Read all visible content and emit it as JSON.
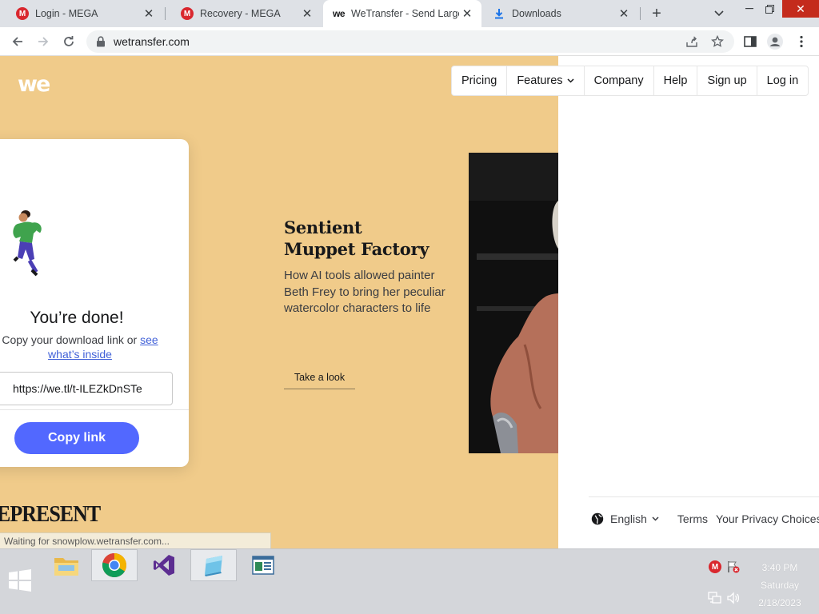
{
  "browser": {
    "tabs": [
      {
        "title": "Login - MEGA",
        "favicon": "mega-icon",
        "active": false
      },
      {
        "title": "Recovery - MEGA",
        "favicon": "mega-icon",
        "active": false
      },
      {
        "title": "WeTransfer - Send Large",
        "favicon": "wetransfer-icon",
        "active": true
      },
      {
        "title": "Downloads",
        "favicon": "download-icon",
        "active": false
      }
    ],
    "close_glyph": "✕",
    "new_tab_glyph": "+",
    "url": "wetransfer.com"
  },
  "page": {
    "logo_text": "we",
    "nav": {
      "pricing": "Pricing",
      "features": "Features",
      "company": "Company",
      "help": "Help",
      "signup": "Sign up",
      "login": "Log in"
    },
    "card": {
      "title": "You’re done!",
      "subtitle_prefix": "Copy your download link or",
      "subtitle_link": "see what’s inside",
      "link_value": "https://we.tl/t-ILEZkDnSTe",
      "copy_button": "Copy link"
    },
    "ad": {
      "title_line1": "Sentient",
      "title_line2": "Muppet Factory",
      "description": "How AI tools allowed painter Beth Frey to bring her peculiar watercolor characters to life",
      "cta": "Take a look"
    },
    "bottom_text": "EPRESENT",
    "status": "Waiting for snowplow.wetransfer.com...",
    "footer": {
      "language": "English",
      "terms": "Terms",
      "privacy": "Your Privacy Choices"
    }
  },
  "taskbar": {
    "time": "3:40 PM",
    "day": "Saturday",
    "date": "2/18/2023"
  },
  "colors": {
    "yellow_bg": "#f0cb8a",
    "copy_button": "#5268ff",
    "link": "#4161d8",
    "mega_red": "#d9272e",
    "window_close": "#c42b1c"
  }
}
